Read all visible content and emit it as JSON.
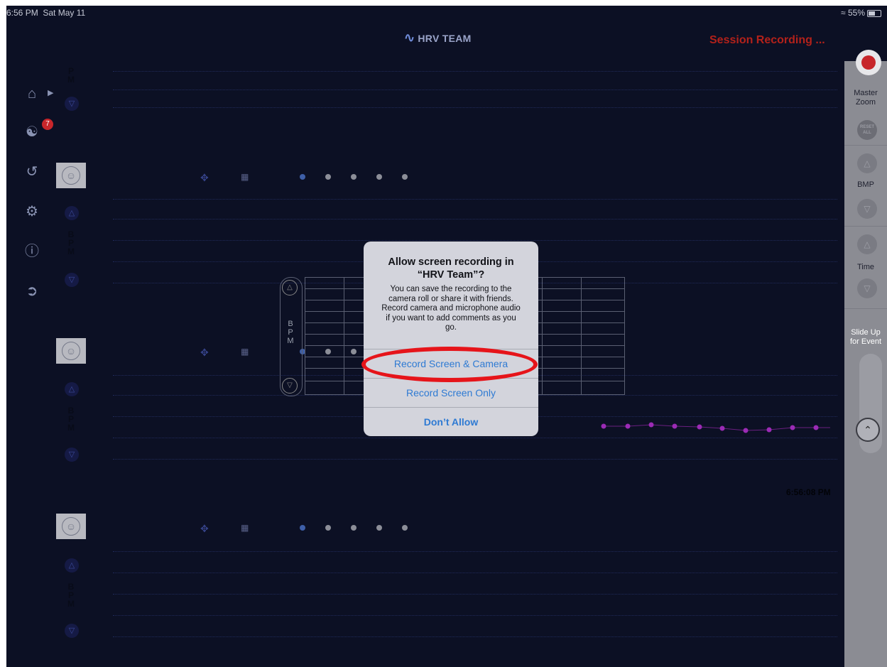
{
  "status_bar": {
    "time": "6:56 PM",
    "date": "Sat May 11",
    "battery": "55%"
  },
  "header": {
    "app_name": "HRV TEAM",
    "session_status": "Session Recording ..."
  },
  "nav": {
    "badge_count": "7"
  },
  "panels": {
    "bpm_letters": [
      "B",
      "P",
      "M"
    ],
    "top_partial_letters": [
      "P",
      "M"
    ]
  },
  "rail": {
    "master_zoom_line1": "Master",
    "master_zoom_line2": "Zoom",
    "reset_line1": "RESET",
    "reset_line2": "ALL",
    "bpm_label": "BMP",
    "time_label": "Time",
    "slide_up_line1": "Slide Up",
    "slide_up_line2": "for Event"
  },
  "timestamp": "6:56:08 PM",
  "dialog": {
    "title_line1": "Allow screen recording in",
    "title_line2": "“HRV Team”?",
    "message_line1": "You can save the recording to the",
    "message_line2": "camera roll or share it with friends.",
    "message_line3": "Record camera and microphone audio",
    "message_line4": "if you want to add comments as you",
    "message_line5": "go.",
    "btn_record_camera": "Record Screen & Camera",
    "btn_record_only": "Record Screen Only",
    "btn_deny": "Don’t Allow"
  },
  "colors": {
    "background": "#0c1024",
    "recording_red": "#c7262b",
    "dialog_button_blue": "#2e7ad3",
    "highlight_ring": "#e6141a",
    "hr_series": "#9b2bb5"
  },
  "icons": [
    "home-icon",
    "play-icon",
    "team-icon",
    "history-icon",
    "settings-icon",
    "info-icon",
    "logout-icon",
    "move-icon",
    "grid-icon",
    "avatar-icon",
    "up-triangle-icon",
    "down-triangle-icon",
    "record-icon",
    "double-chevron-up-icon"
  ]
}
